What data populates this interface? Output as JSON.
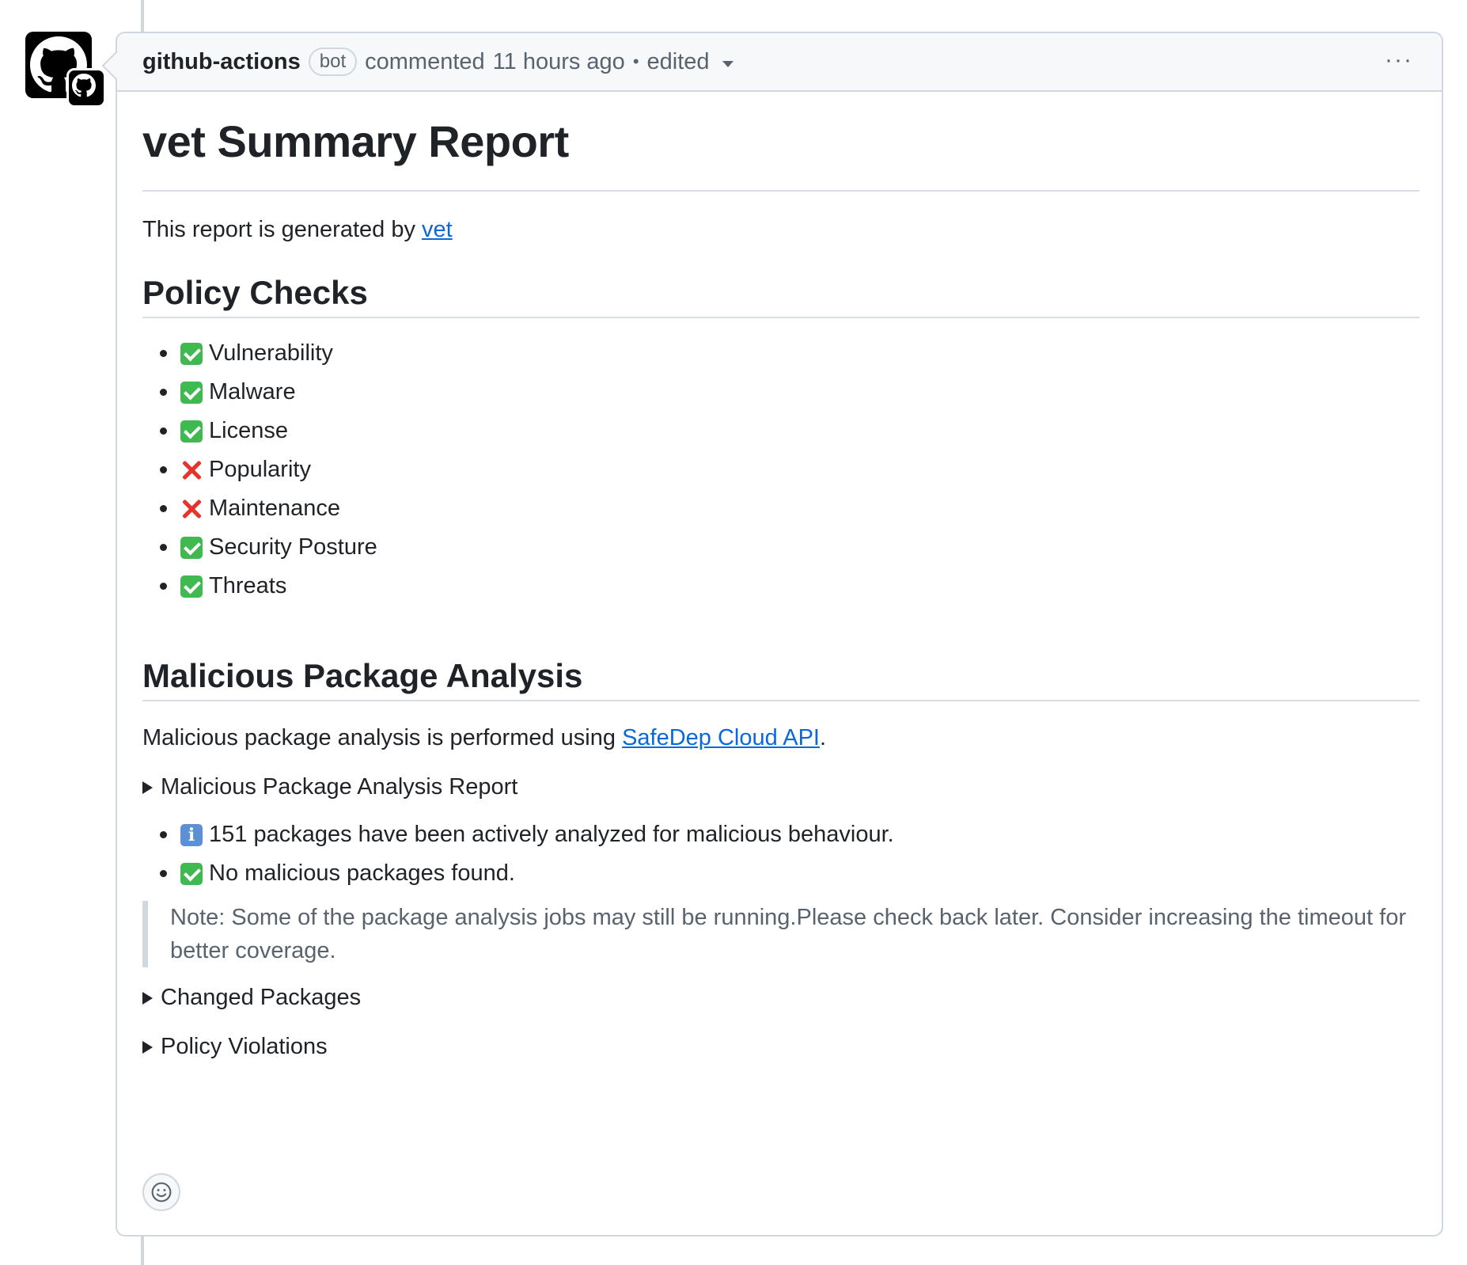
{
  "comment": {
    "author": "github-actions",
    "bot_label": "bot",
    "action": "commented",
    "time": "11 hours ago",
    "separator": "•",
    "edited": "edited",
    "menu": "···"
  },
  "report": {
    "title": "vet Summary Report",
    "intro_text": "This report is generated by ",
    "intro_link": "vet",
    "policy": {
      "heading": "Policy Checks",
      "items": [
        {
          "status": "pass",
          "label": "Vulnerability"
        },
        {
          "status": "pass",
          "label": "Malware"
        },
        {
          "status": "pass",
          "label": "License"
        },
        {
          "status": "fail",
          "label": "Popularity"
        },
        {
          "status": "fail",
          "label": "Maintenance"
        },
        {
          "status": "pass",
          "label": "Security Posture"
        },
        {
          "status": "pass",
          "label": "Threats"
        }
      ]
    },
    "malicious": {
      "heading": "Malicious Package Analysis",
      "text": "Malicious package analysis is performed using ",
      "link": "SafeDep Cloud API",
      "text_end": ".",
      "details_summary": "Malicious Package Analysis Report",
      "items": [
        {
          "status": "info",
          "label": "151 packages have been actively analyzed for malicious behaviour."
        },
        {
          "status": "pass",
          "label": "No malicious packages found."
        }
      ],
      "note": "Note: Some of the package analysis jobs may still be running.Please check back later. Consider increasing the timeout for better coverage."
    },
    "changed_packages": "Changed Packages",
    "policy_violations": "Policy Violations"
  },
  "icons": {
    "avatar": "github-octocat-icon",
    "reaction": "smiley-icon"
  }
}
